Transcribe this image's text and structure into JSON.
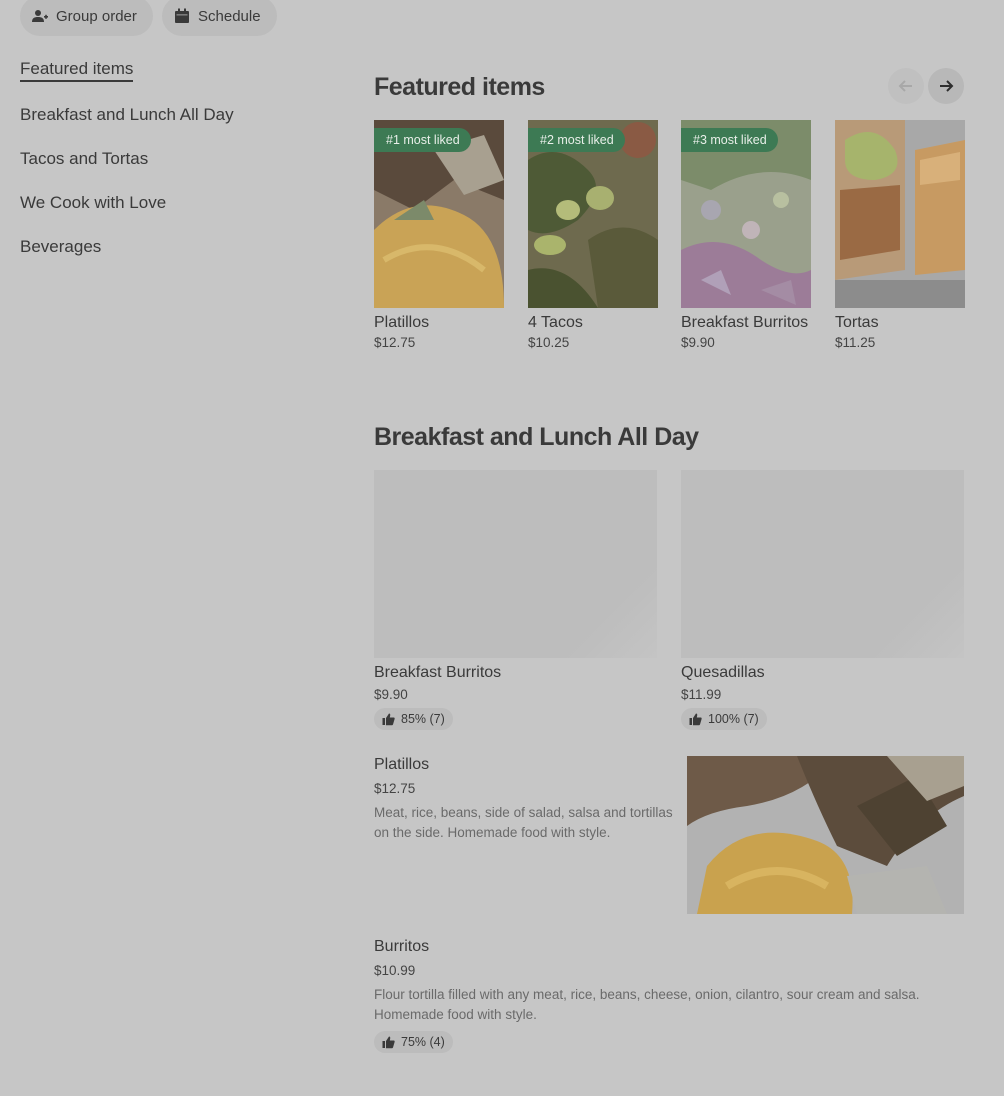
{
  "toolbar": {
    "group_order": "Group order",
    "schedule": "Schedule"
  },
  "sidebar": {
    "items": [
      {
        "label": "Featured items",
        "active": true
      },
      {
        "label": "Breakfast and Lunch All Day"
      },
      {
        "label": "Tacos and Tortas"
      },
      {
        "label": "We Cook with Love"
      },
      {
        "label": "Beverages"
      }
    ]
  },
  "featured": {
    "title": "Featured items",
    "items": [
      {
        "badge": "#1 most liked",
        "name": "Platillos",
        "price": "$12.75"
      },
      {
        "badge": "#2 most liked",
        "name": "4 Tacos",
        "price": "$10.25"
      },
      {
        "badge": "#3 most liked",
        "name": "Breakfast Burritos",
        "price": "$9.90"
      },
      {
        "name": "Tortas",
        "price": "$11.25"
      }
    ]
  },
  "breakfast": {
    "title": "Breakfast and Lunch All Day",
    "cards": [
      {
        "name": "Breakfast Burritos",
        "price": "$9.90",
        "rating": "85% (7)"
      },
      {
        "name": "Quesadillas",
        "price": "$11.99",
        "rating": "100% (7)"
      }
    ],
    "list": [
      {
        "name": "Platillos",
        "price": "$12.75",
        "description": "Meat, rice, beans, side of salad, salsa and tortillas on the side. Homemade food with style."
      },
      {
        "name": "Burritos",
        "price": "$10.99",
        "description": "Flour tortilla filled with any meat, rice, beans, cheese, onion, cilantro, sour cream and salsa. Homemade food with style.",
        "rating": "75% (4)"
      }
    ]
  },
  "colors": {
    "background": "#c6c6c6",
    "badge": "#3d7a54",
    "pill": "#bcbcbc"
  },
  "icons": [
    "add-person-icon",
    "calendar-icon",
    "arrow-left-icon",
    "arrow-right-icon",
    "thumbs-up-icon"
  ]
}
